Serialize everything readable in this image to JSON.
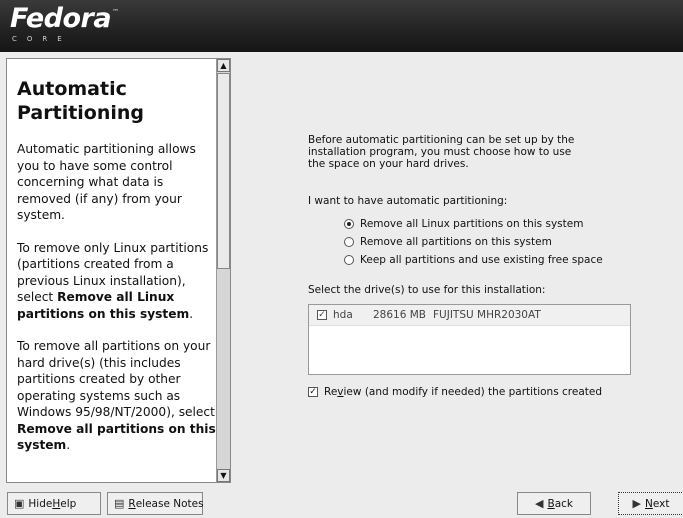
{
  "header": {
    "brand": "Fedora",
    "tm": "™",
    "sub": "CORE"
  },
  "help": {
    "title": "Automatic Partitioning",
    "para1": "Automatic partitioning allows you to have some control concerning what data is removed (if any) from your system.",
    "para2_pre": "To remove only Linux partitions (partitions created from a previous Linux installation), select ",
    "para2_bold": "Remove all Linux partitions on this system",
    "para2_post": ".",
    "para3_pre": "To remove all partitions on your hard drive(s) (this includes partitions created by other operating systems such as Windows 95/98/NT/2000), select ",
    "para3_bold": "Remove all partitions on this system",
    "para3_post": "."
  },
  "main": {
    "intro": "Before automatic partitioning can be set up by the installation program, you must choose how to use the space on your hard drives.",
    "question": "I want to have automatic partitioning:",
    "options": [
      {
        "label": "Remove all Linux partitions on this system",
        "selected": true
      },
      {
        "label": "Remove all partitions on this system",
        "selected": false
      },
      {
        "label": "Keep all partitions and use existing free space",
        "selected": false
      }
    ],
    "drives_label": "Select the drive(s) to use for this installation:",
    "drives": [
      {
        "checked": true,
        "device": "hda",
        "size": "28616 MB",
        "model": "FUJITSU MHR2030AT"
      }
    ],
    "review": {
      "checked": true,
      "label_pre": "Re",
      "label_u": "v",
      "label_post": "iew (and modify if needed) the partitions created"
    }
  },
  "buttons": {
    "hide_help": {
      "pre": "Hide ",
      "u": "H",
      "post": "elp"
    },
    "release_notes": {
      "pre": "",
      "u": "R",
      "post": "elease Notes"
    },
    "back": {
      "pre": "",
      "u": "B",
      "post": "ack"
    },
    "next": {
      "pre": "",
      "u": "N",
      "post": "ext"
    }
  }
}
